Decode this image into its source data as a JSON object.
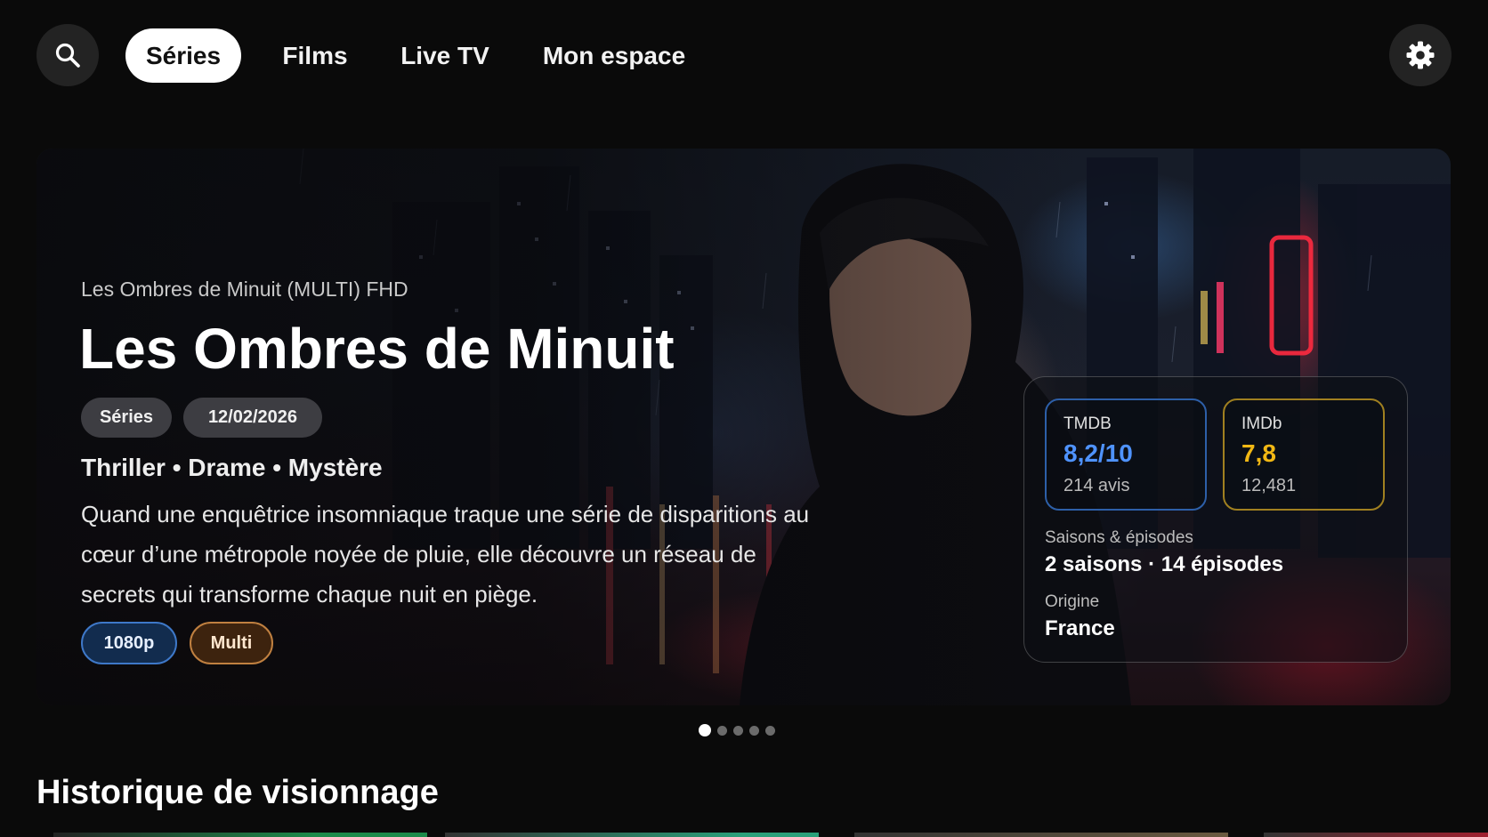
{
  "nav": {
    "tabs": [
      {
        "label": "Séries",
        "active": true
      },
      {
        "label": "Films",
        "active": false
      },
      {
        "label": "Live TV",
        "active": false
      },
      {
        "label": "Mon espace",
        "active": false
      }
    ],
    "search_icon": "search-icon",
    "settings_icon": "gear-icon"
  },
  "hero": {
    "kicker": "Les Ombres de Minuit (MULTI) FHD",
    "title": "Les Ombres de Minuit",
    "chips": [
      "Séries",
      "12/02/2026"
    ],
    "genres": "Thriller • Drame • Mystère",
    "synopsis": "Quand une enquêtrice insomniaque traque une série de disparitions au cœur d’une métropole noyée de pluie, elle découvre un réseau de secrets qui transforme chaque nuit en piège.",
    "badges": {
      "resolution": "1080p",
      "language": "Multi"
    },
    "ratings": {
      "tmdb": {
        "source": "TMDB",
        "value": "8,2/10",
        "sub": "214 avis",
        "color": "#4f93ff"
      },
      "imdb": {
        "source": "IMDb",
        "value": "7,8",
        "sub": "12,481",
        "color": "#f2b814"
      }
    },
    "meta": {
      "seasons_label": "Saisons & épisodes",
      "seasons_value": "2 saisons · 14 épisodes",
      "origin_label": "Origine",
      "origin_value": "France"
    }
  },
  "carousel": {
    "count": 5,
    "active_index": 0
  },
  "history": {
    "title": "Historique de visionnage"
  }
}
